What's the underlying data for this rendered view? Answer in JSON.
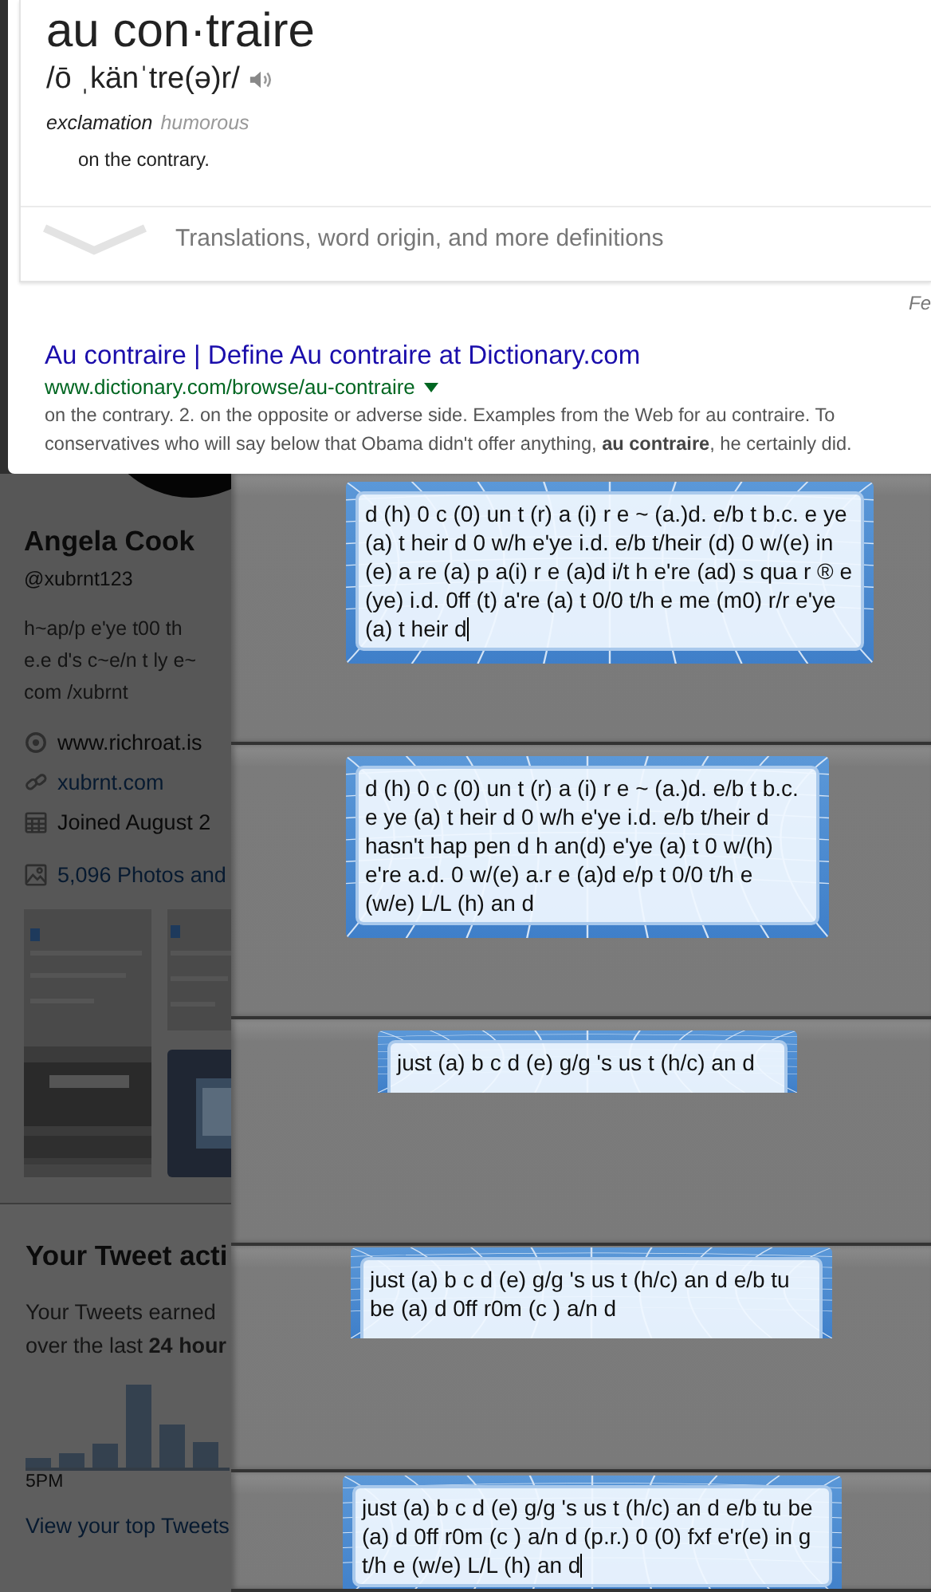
{
  "definition": {
    "headword": "au con·traire",
    "pronunciation": "/ō ˌkänˈtre(ə)r/",
    "part_of_speech": "exclamation",
    "register": "humorous",
    "sense": "on the contrary.",
    "more_link": "Translations, word origin, and more definitions"
  },
  "feedback": "Fe",
  "result": {
    "title": "Au contraire | Define Au contraire at Dictionary.com",
    "url": "www.dictionary.com/browse/au-contraire",
    "snippet": "on the contrary. 2. on the opposite or adverse side. Examples from the Web for au contraire. To conservatives who will say below that Obama didn't offer anything, **au contraire**, he certainly did."
  },
  "profile": {
    "name": "Angela Cook",
    "handle": "@xubrnt123",
    "bio_lines": [
      "h~ap/p e'ye t00 th",
      "e.e d's c~e/n t ly e~",
      "com /xubrnt"
    ],
    "details": [
      {
        "kind": "location",
        "text": "www.richroat.is"
      },
      {
        "kind": "link",
        "text": "xubrnt.com"
      },
      {
        "kind": "joined",
        "text": "Joined August 2"
      },
      {
        "kind": "photos",
        "text": "5,096 Photos and"
      }
    ]
  },
  "activity": {
    "title": "Your Tweet acti",
    "summary_lines": [
      "Your Tweets earned",
      "over the last **24 hour**"
    ],
    "time_label": "5PM",
    "link": "View your top Tweets"
  },
  "messages": [
    {
      "text": "d (h) 0 c (0) un t (r) a (i) r e ~ (a.)d. e/b t b.c. e ye (a) t heir d 0 w/h e'ye i.d. e/b t/heir (d) 0 w/(e) in (e) a re (a) p a(i) r e (a)d i/t h e're (ad) s qua r ® e (ye) i.d. 0ff (t) a're (a) t 0/0 t/h e me (m0) r/r e'ye (a) t heir d",
      "caret": true,
      "clipped": false
    },
    {
      "text": "d (h) 0 c (0) un t (r) a (i) r e ~ (a.)d. e/b t b.c. e ye (a) t heir d 0 w/h e'ye i.d. e/b t/heir d hasn't hap pen d h an(d) e'ye (a) t 0 w/(h) e're a.d. 0 w/(e) a.r e (a)d e/p t 0/0 t/h e (w/e) L/L (h) an d",
      "caret": false,
      "clipped": false
    },
    {
      "text": "just (a) b c d (e) g/g 's us t (h/c) an d",
      "caret": false,
      "clipped": true
    },
    {
      "text": "just (a) b c d (e) g/g 's us t (h/c) an d e/b tu be (a) d 0ff r0m (c ) a/n d",
      "caret": false,
      "clipped": true
    },
    {
      "text": "just (a) b c d (e) g/g 's us t (h/c) an d e/b tu be (a) d 0ff r0m (c ) a/n d (p.r.) 0 (0) fxf e'r(e) in g t/h e (w/e) L/L (h) an d",
      "caret": true,
      "clipped": false
    }
  ]
}
